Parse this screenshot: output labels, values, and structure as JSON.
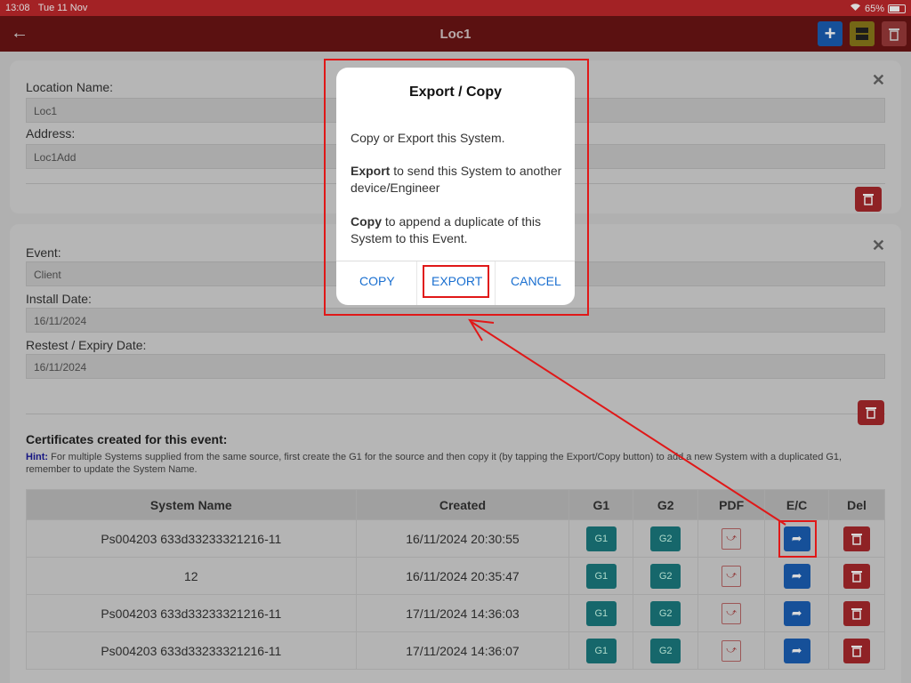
{
  "status": {
    "time": "13:08",
    "date": "Tue 11 Nov",
    "battery": "65%"
  },
  "nav": {
    "title": "Loc1",
    "add_label": "+"
  },
  "location": {
    "name_label": "Location Name:",
    "name_value": "Loc1",
    "address_label": "Address:",
    "address_value": "Loc1Add"
  },
  "event": {
    "event_label": "Event:",
    "event_value": "Client",
    "install_label": "Install Date:",
    "install_value": "16/11/2024",
    "retest_label": "Restest / Expiry Date:",
    "retest_value": "16/11/2024"
  },
  "certs": {
    "heading": "Certificates created for this event:",
    "hint_label": "Hint:",
    "hint_text": " For multiple Systems supplied from the same source, first create the G1 for the source and then copy it (by tapping the Export/Copy button) to add a new System with a duplicated G1, remember to update the System Name."
  },
  "table": {
    "headers": [
      "System Name",
      "Created",
      "G1",
      "G2",
      "PDF",
      "E/C",
      "Del"
    ],
    "rows": [
      {
        "name": "Ps004203 633d33233321216-11",
        "created": "16/11/2024 20:30:55"
      },
      {
        "name": "12",
        "created": "16/11/2024 20:35:47"
      },
      {
        "name": "Ps004203 633d33233321216-11",
        "created": "17/11/2024 14:36:03"
      },
      {
        "name": "Ps004203 633d33233321216-11",
        "created": "17/11/2024 14:36:07"
      }
    ],
    "g1_label": "G1",
    "g2_label": "G2"
  },
  "dialog": {
    "title": "Export / Copy",
    "intro": "Copy or Export this System.",
    "export_bold": "Export",
    "export_text": " to send this System to another device/Engineer",
    "copy_bold": "Copy",
    "copy_text": " to append a duplicate of this System to this Event.",
    "copy_btn": "COPY",
    "export_btn": "EXPORT",
    "cancel_btn": "CANCEL"
  },
  "colors": {
    "statusbar": "#c0282c",
    "navbar": "#6b1515",
    "annotation": "#e01818",
    "link": "#1a6fd0"
  }
}
